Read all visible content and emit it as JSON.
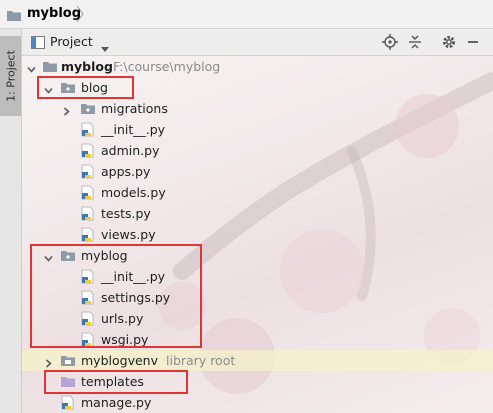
{
  "breadcrumb": {
    "project": "myblog"
  },
  "sidebar": {
    "tab_label": "1: Project"
  },
  "toolbar": {
    "view_label": "Project"
  },
  "tree": {
    "root": {
      "name": "myblog",
      "path": "F:\\course\\myblog"
    },
    "blog": {
      "name": "blog",
      "children": [
        "migrations",
        "__init__.py",
        "admin.py",
        "apps.py",
        "models.py",
        "tests.py",
        "views.py"
      ]
    },
    "myblog_pkg": {
      "name": "myblog",
      "children": [
        "__init__.py",
        "settings.py",
        "urls.py",
        "wsgi.py"
      ]
    },
    "venv": {
      "name": "myblogvenv",
      "note": "library root"
    },
    "templates": {
      "name": "templates"
    },
    "manage": {
      "name": "manage.py"
    }
  },
  "colors": {
    "highlight_box": "#e03535",
    "folder": "#8e9aa6",
    "templates_folder": "#b9a2d6",
    "library_row": "#f6f1c8"
  }
}
